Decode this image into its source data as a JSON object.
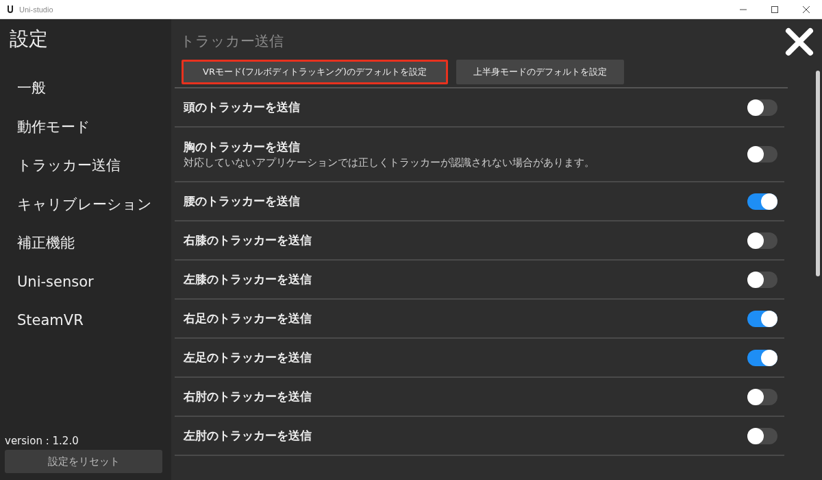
{
  "window": {
    "title": "Uni-studio"
  },
  "sidebar": {
    "title": "設定",
    "items": [
      {
        "label": "一般"
      },
      {
        "label": "動作モード"
      },
      {
        "label": "トラッカー送信"
      },
      {
        "label": "キャリブレーション"
      },
      {
        "label": "補正機能"
      },
      {
        "label": "Uni-sensor"
      },
      {
        "label": "SteamVR"
      }
    ],
    "version": "version : 1.2.0",
    "reset_button": "設定をリセット"
  },
  "section_title": "トラッカー送信",
  "preset_buttons": [
    {
      "label": "VRモード(フルボディトラッキング)のデフォルトを設定",
      "highlighted": true
    },
    {
      "label": "上半身モードのデフォルトを設定",
      "highlighted": false
    }
  ],
  "settings": [
    {
      "label": "頭のトラッカーを送信",
      "on": false
    },
    {
      "label": "胸のトラッカーを送信",
      "note": "対応していないアプリケーションでは正しくトラッカーが認識されない場合があります。",
      "on": false
    },
    {
      "label": "腰のトラッカーを送信",
      "on": true
    },
    {
      "label": "右膝のトラッカーを送信",
      "on": false
    },
    {
      "label": "左膝のトラッカーを送信",
      "on": false
    },
    {
      "label": "右足のトラッカーを送信",
      "on": true
    },
    {
      "label": "左足のトラッカーを送信",
      "on": true
    },
    {
      "label": "右肘のトラッカーを送信",
      "on": false
    },
    {
      "label": "左肘のトラッカーを送信",
      "on": false
    }
  ]
}
